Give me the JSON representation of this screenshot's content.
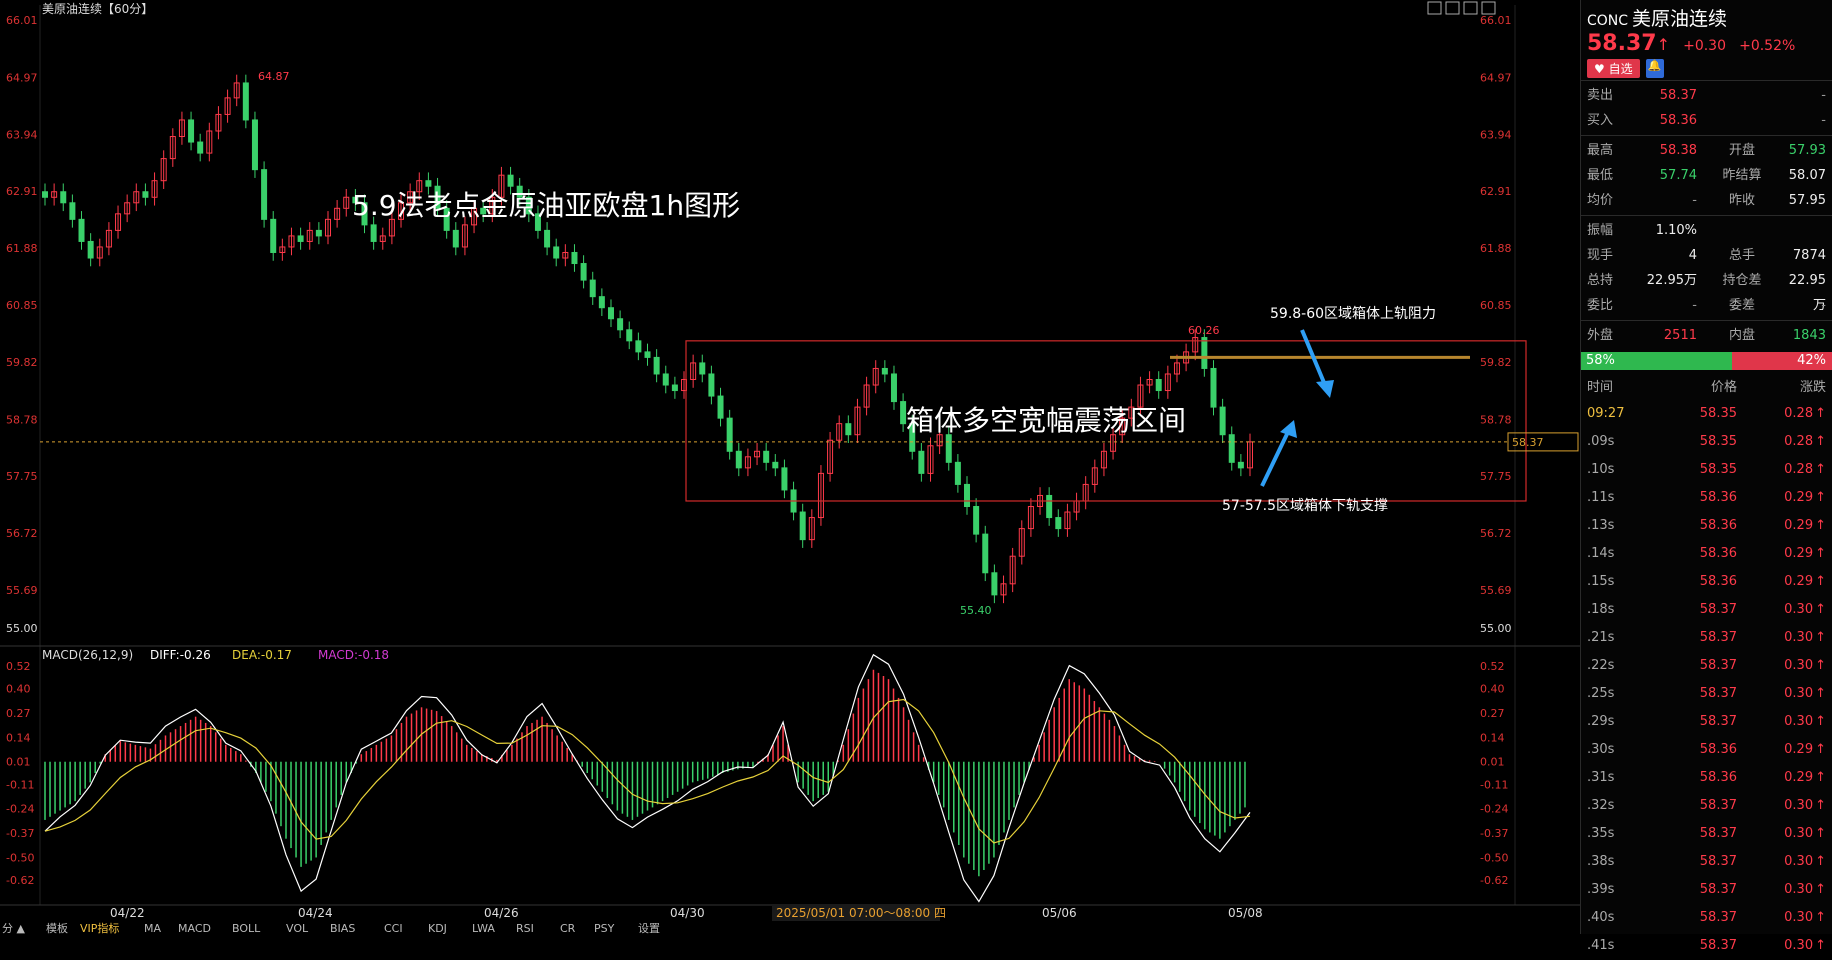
{
  "chart_title": "美原油连续【60分】",
  "toolbar_icons": [
    "grid-icon",
    "chart-icon",
    "fullscreen-icon",
    "settings-icon"
  ],
  "annotations": {
    "main_title": "5.9法老点金原油亚欧盘1h图形",
    "box_label": "箱体多空宽幅震荡区间",
    "upper_label": "59.8-60区域箱体上轨阻力",
    "lower_label": "57-57.5区域箱体下轨支撑"
  },
  "price_axis_labels": [
    "66.01",
    "64.97",
    "63.94",
    "62.91",
    "61.88",
    "60.85",
    "59.82",
    "58.78",
    "57.75",
    "56.72",
    "55.69",
    "55.00"
  ],
  "current_price_tag": "58.37",
  "high_marker": "64.87",
  "low_marker": "55.40",
  "local_high_marker": "60.26",
  "macd_header": {
    "name": "MACD(26,12,9)",
    "diff": "DIFF:-0.26",
    "dea": "DEA:-0.17",
    "macd": "MACD:-0.18"
  },
  "macd_axis_labels": [
    "0.52",
    "0.40",
    "0.27",
    "0.14",
    "0.01",
    "-0.11",
    "-0.24",
    "-0.37",
    "-0.50",
    "-0.62"
  ],
  "date_labels": [
    "04/22",
    "04/24",
    "04/26",
    "04/30",
    "05/06",
    "05/08"
  ],
  "crosshair_date": "2025/05/01 07:00～08:00 四",
  "bottom_tabs": [
    "分 ▲",
    "模板",
    "VIP指标",
    "MA",
    "MACD",
    "BOLL",
    "VOL",
    "BIAS",
    "CCI",
    "KDJ",
    "LWA",
    "RSI",
    "CR",
    "PSY",
    "设置"
  ],
  "colors": {
    "up": "#ff3a4a",
    "down": "#3ad06a",
    "box": "#d12a2a",
    "resistance": "#b8862e",
    "arrow": "#2f9ff5",
    "dif": "#ffffff",
    "dea": "#e6d13a"
  },
  "chart_data": {
    "type": "candlestick",
    "ylim": [
      55.0,
      66.01
    ],
    "box": {
      "start": "04/30",
      "end": "05/08",
      "low": 57.3,
      "high": 60.2
    },
    "resistance_line": 59.9,
    "current_price": 58.37,
    "close_series": [
      62.8,
      62.9,
      62.7,
      62.4,
      62.0,
      61.7,
      61.9,
      62.2,
      62.5,
      62.7,
      62.9,
      62.8,
      63.1,
      63.5,
      63.9,
      64.2,
      63.8,
      63.6,
      64.0,
      64.3,
      64.6,
      64.87,
      64.2,
      63.3,
      62.4,
      61.8,
      61.9,
      62.1,
      62.0,
      62.2,
      62.1,
      62.4,
      62.6,
      62.8,
      62.7,
      62.3,
      62.0,
      62.1,
      62.4,
      62.7,
      62.9,
      63.1,
      63.0,
      62.6,
      62.2,
      61.9,
      62.3,
      62.6,
      62.5,
      62.8,
      63.2,
      63.0,
      62.8,
      62.5,
      62.2,
      61.9,
      61.7,
      61.8,
      61.6,
      61.3,
      61.0,
      60.8,
      60.6,
      60.4,
      60.2,
      60.0,
      59.9,
      59.6,
      59.4,
      59.3,
      59.5,
      59.8,
      59.6,
      59.2,
      58.8,
      58.2,
      57.9,
      58.1,
      58.2,
      58.0,
      57.9,
      57.5,
      57.1,
      56.6,
      57.0,
      57.8,
      58.4,
      58.7,
      58.5,
      59.0,
      59.4,
      59.7,
      59.6,
      59.1,
      58.7,
      58.2,
      57.8,
      58.3,
      58.5,
      58.0,
      57.6,
      57.2,
      56.7,
      56.0,
      55.6,
      55.8,
      56.3,
      56.8,
      57.2,
      57.4,
      57.0,
      56.8,
      57.1,
      57.3,
      57.6,
      57.9,
      58.2,
      58.5,
      58.8,
      59.0,
      59.4,
      59.5,
      59.3,
      59.6,
      59.8,
      60.0,
      60.26,
      59.7,
      59.0,
      58.5,
      58.0,
      57.9,
      58.37
    ],
    "macd_hist": [
      -0.3,
      -0.25,
      -0.2,
      -0.1,
      0.05,
      0.12,
      0.1,
      0.08,
      0.15,
      0.2,
      0.25,
      0.2,
      0.1,
      0.05,
      -0.05,
      -0.2,
      -0.4,
      -0.55,
      -0.5,
      -0.3,
      -0.1,
      0.05,
      0.1,
      0.15,
      0.25,
      0.3,
      0.28,
      0.2,
      0.1,
      0.05,
      0.02,
      0.1,
      0.2,
      0.25,
      0.15,
      0.05,
      -0.05,
      -0.15,
      -0.25,
      -0.3,
      -0.25,
      -0.2,
      -0.15,
      -0.1,
      -0.08,
      -0.05,
      -0.03,
      -0.02,
      0.05,
      0.2,
      -0.1,
      -0.2,
      -0.15,
      0.1,
      0.35,
      0.5,
      0.45,
      0.3,
      0.1,
      -0.1,
      -0.3,
      -0.5,
      -0.6,
      -0.5,
      -0.3,
      -0.1,
      0.1,
      0.3,
      0.45,
      0.4,
      0.3,
      0.2,
      0.05,
      0.02,
      0.01,
      -0.1,
      -0.25,
      -0.35,
      -0.4,
      -0.3,
      -0.2
    ]
  },
  "quote": {
    "code": "CONC",
    "name": "美原油连续",
    "price": "58.37",
    "change": "+0.30",
    "change_pct": "+0.52%",
    "fav_label": "自选",
    "rows": [
      {
        "l1": "卖出",
        "v1": "58.37",
        "c1": "red",
        "l2": "",
        "v2": "-",
        "c2": "grey"
      },
      {
        "l1": "买入",
        "v1": "58.36",
        "c1": "red",
        "l2": "",
        "v2": "-",
        "c2": "grey"
      },
      {
        "l1": "最高",
        "v1": "58.38",
        "c1": "red",
        "l2": "开盘",
        "v2": "57.93",
        "c2": "green"
      },
      {
        "l1": "最低",
        "v1": "57.74",
        "c1": "green",
        "l2": "昨结算",
        "v2": "58.07",
        "c2": "white"
      },
      {
        "l1": "均价",
        "v1": "-",
        "c1": "grey",
        "l2": "昨收",
        "v2": "57.95",
        "c2": "white"
      },
      {
        "l1": "振幅",
        "v1": "1.10%",
        "c1": "white",
        "l2": "",
        "v2": "",
        "c2": "white"
      },
      {
        "l1": "现手",
        "v1": "4",
        "c1": "white",
        "l2": "总手",
        "v2": "7874",
        "c2": "white"
      },
      {
        "l1": "总持",
        "v1": "22.95万",
        "c1": "white",
        "l2": "持仓差",
        "v2": "22.95万",
        "c2": "white"
      },
      {
        "l1": "委比",
        "v1": "-",
        "c1": "grey",
        "l2": "委差",
        "v2": "-",
        "c2": "grey"
      },
      {
        "l1": "外盘",
        "v1": "2511",
        "c1": "red",
        "l2": "内盘",
        "v2": "1843",
        "c2": "green"
      }
    ],
    "ratio_green": "58%",
    "ratio_red": "42%",
    "ratio_green_fraction": 0.58,
    "tick_headers": [
      "时间",
      "价格",
      "涨跌"
    ],
    "ticks": [
      {
        "t": "09:27",
        "p": "58.35",
        "c": "0.28"
      },
      {
        "t": ".09s",
        "p": "58.35",
        "c": "0.28"
      },
      {
        "t": ".10s",
        "p": "58.35",
        "c": "0.28"
      },
      {
        "t": ".11s",
        "p": "58.36",
        "c": "0.29"
      },
      {
        "t": ".13s",
        "p": "58.36",
        "c": "0.29"
      },
      {
        "t": ".14s",
        "p": "58.36",
        "c": "0.29"
      },
      {
        "t": ".15s",
        "p": "58.36",
        "c": "0.29"
      },
      {
        "t": ".18s",
        "p": "58.37",
        "c": "0.30"
      },
      {
        "t": ".21s",
        "p": "58.37",
        "c": "0.30"
      },
      {
        "t": ".22s",
        "p": "58.37",
        "c": "0.30"
      },
      {
        "t": ".25s",
        "p": "58.37",
        "c": "0.30"
      },
      {
        "t": ".29s",
        "p": "58.37",
        "c": "0.30"
      },
      {
        "t": ".30s",
        "p": "58.36",
        "c": "0.29"
      },
      {
        "t": ".31s",
        "p": "58.36",
        "c": "0.29"
      },
      {
        "t": ".32s",
        "p": "58.37",
        "c": "0.30"
      },
      {
        "t": ".35s",
        "p": "58.37",
        "c": "0.30"
      },
      {
        "t": ".38s",
        "p": "58.37",
        "c": "0.30"
      },
      {
        "t": ".39s",
        "p": "58.37",
        "c": "0.30"
      },
      {
        "t": ".40s",
        "p": "58.37",
        "c": "0.30"
      },
      {
        "t": ".41s",
        "p": "58.37",
        "c": "0.30"
      }
    ]
  }
}
